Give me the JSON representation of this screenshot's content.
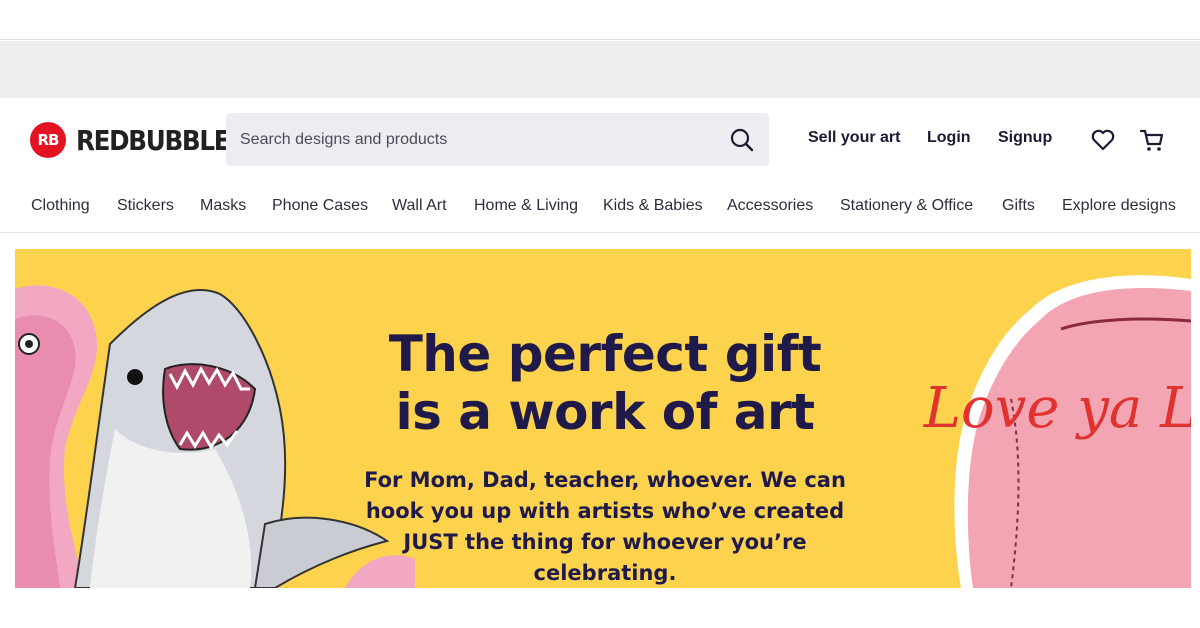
{
  "brand": {
    "name": "REDBUBBLE",
    "mark": "RB",
    "color": "#e41321"
  },
  "search": {
    "placeholder": "Search designs and products",
    "value": ""
  },
  "header_links": {
    "sell": "Sell your art",
    "login": "Login",
    "signup": "Signup"
  },
  "header_icons": [
    "heart-icon",
    "cart-icon",
    "search-icon"
  ],
  "categories": [
    "Clothing",
    "Stickers",
    "Masks",
    "Phone Cases",
    "Wall Art",
    "Home & Living",
    "Kids & Babies",
    "Accessories",
    "Stationery & Office",
    "Gifts",
    "Explore designs"
  ],
  "hero": {
    "title": "The perfect gift is a work of art",
    "subtitle": "For Mom, Dad, teacher, whoever. We can hook you up with artists who’ve created JUST the thing for whoever you’re celebrating.",
    "jacket_text": "Love ya Lady",
    "background": "#fdd34e"
  },
  "colors": {
    "text": "#1a1a33",
    "hero_text": "#1f1a4a",
    "search_bg": "#ededf1",
    "promo_bg": "#ededf0"
  }
}
